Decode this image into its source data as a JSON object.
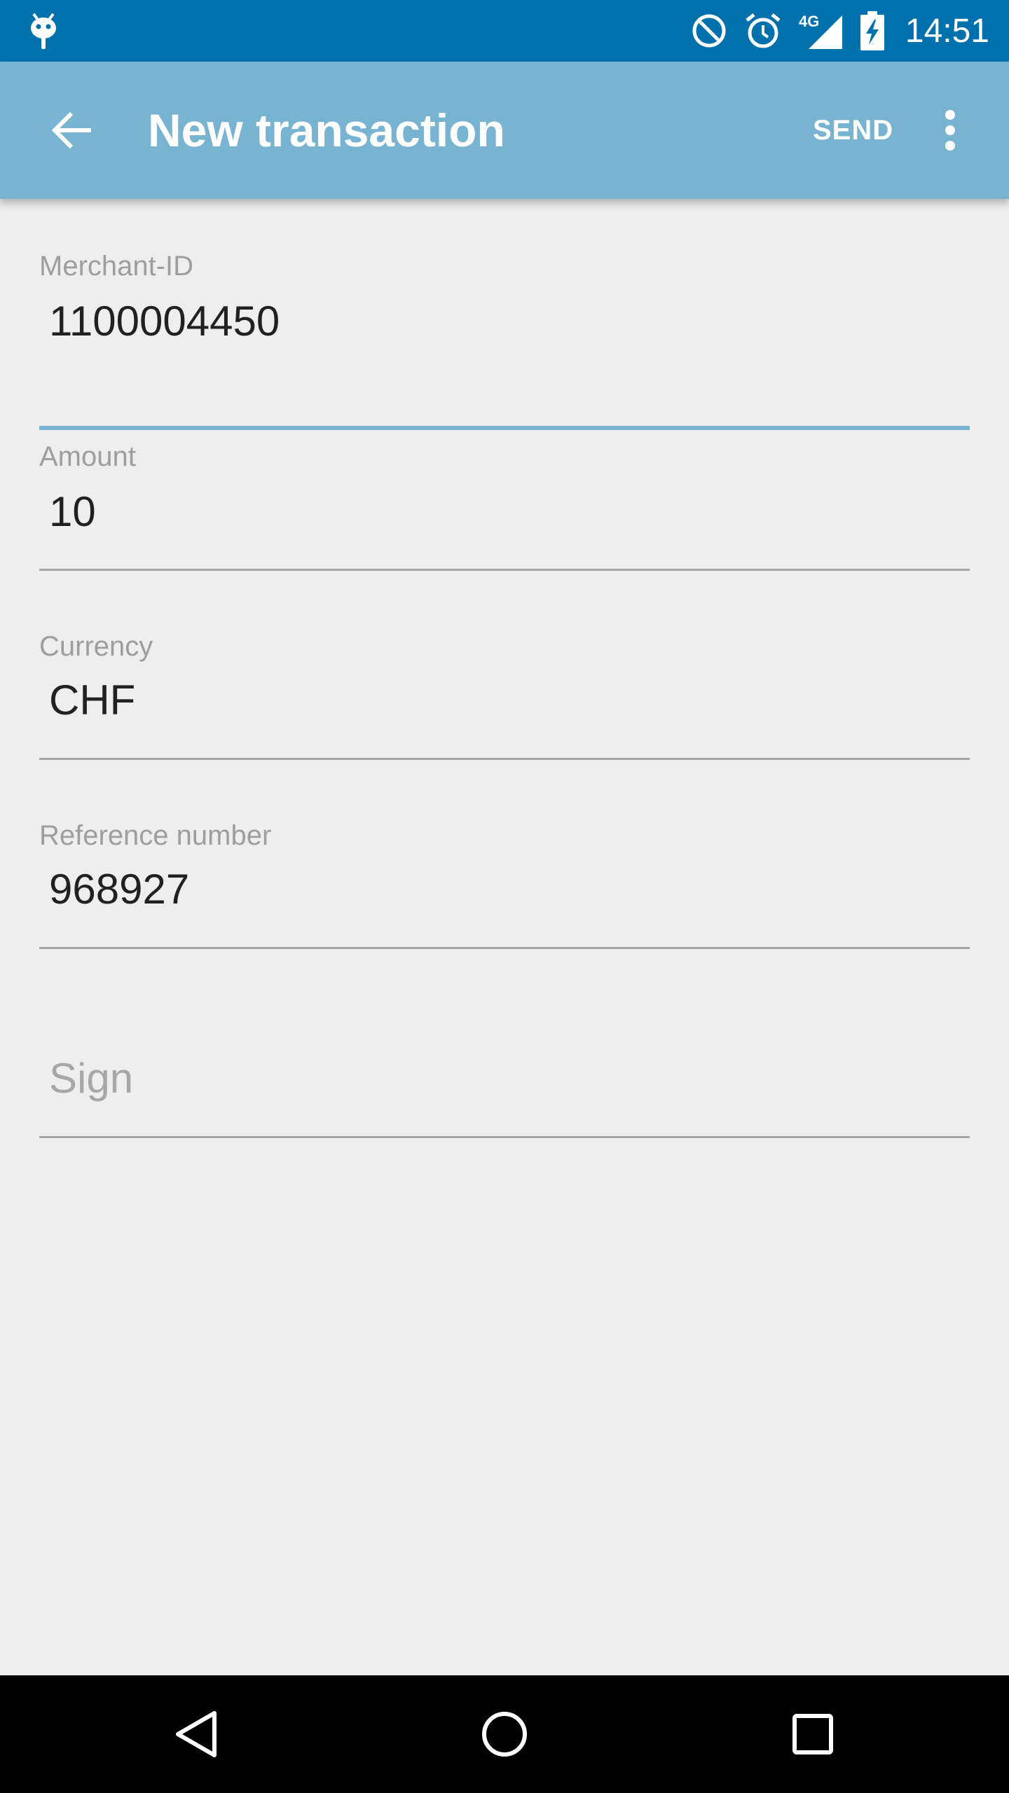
{
  "status_bar": {
    "time": "14:51",
    "network_label": "4G",
    "icons": [
      "android-debug-icon",
      "do-not-disturb-icon",
      "alarm-icon",
      "signal-4g-icon",
      "battery-charging-icon"
    ],
    "background_color": "#0071ad"
  },
  "app_bar": {
    "title": "New transaction",
    "send_label": "SEND",
    "back_icon": "arrow-back-icon",
    "overflow_icon": "more-vert-icon",
    "background_color": "#78b4d2"
  },
  "form": {
    "merchant_id": {
      "label": "Merchant-ID",
      "value": "1100004450",
      "focused": true
    },
    "amount": {
      "label": "Amount",
      "value": "10"
    },
    "currency": {
      "label": "Currency",
      "value": "CHF"
    },
    "reference_number": {
      "label": "Reference number",
      "value": "968927"
    },
    "sign": {
      "placeholder": "Sign",
      "value": ""
    }
  },
  "nav_bar": {
    "icons": [
      "nav-back-icon",
      "nav-home-icon",
      "nav-recents-icon"
    ]
  }
}
